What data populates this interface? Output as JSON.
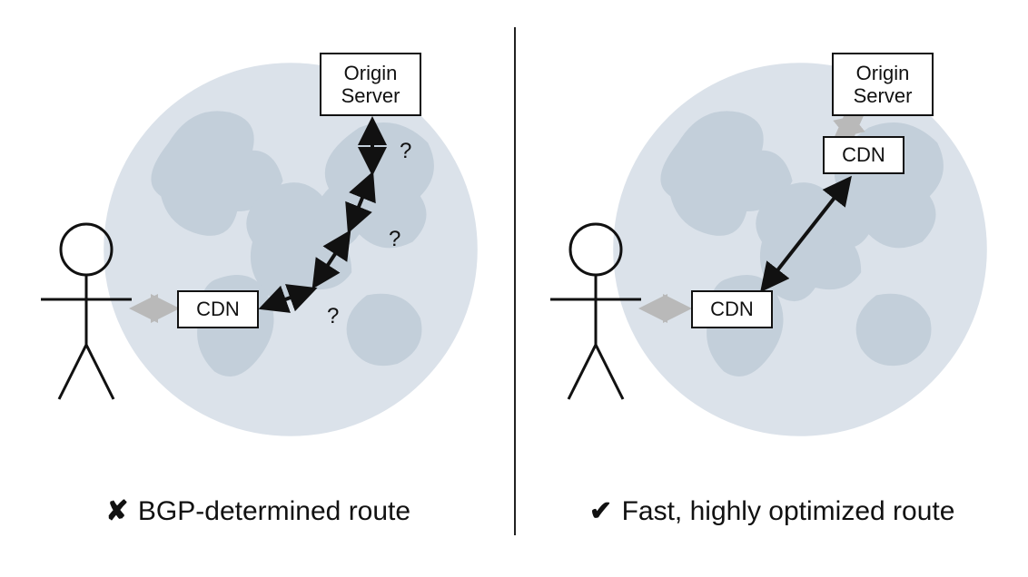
{
  "left": {
    "origin_label": "Origin\nServer",
    "cdn_label": "CDN",
    "q1": "?",
    "q2": "?",
    "q3": "?",
    "caption_mark": "✘",
    "caption_text": "BGP-determined route"
  },
  "right": {
    "origin_label": "Origin\nServer",
    "cdn_top_label": "CDN",
    "cdn_bottom_label": "CDN",
    "caption_mark": "✔",
    "caption_text": "Fast, highly optimized route"
  }
}
